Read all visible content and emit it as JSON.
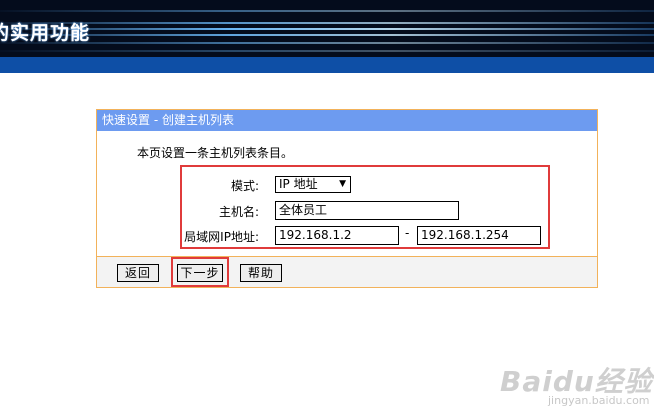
{
  "banner": {
    "title": "的实用功能"
  },
  "panel": {
    "header": "快速设置 - 创建主机列表",
    "intro": "本页设置一条主机列表条目。",
    "mode": {
      "label": "模式:",
      "selected": "IP 地址"
    },
    "hostname": {
      "label": "主机名:",
      "value": "全体员工"
    },
    "lan_ip": {
      "label": "局域网IP地址:",
      "start": "192.168.1.2",
      "separator": "-",
      "end": "192.168.1.254"
    },
    "buttons": {
      "back": "返回",
      "next": "下一步",
      "help": "帮助"
    }
  },
  "watermark": {
    "logo": "Baidu经验",
    "url": "jingyan.baidu.com"
  },
  "colors": {
    "panel_header": "#6d9bf0",
    "panel_border": "#f2b25a",
    "highlight": "#e03b3b",
    "blue_bar": "#0e4fa6"
  }
}
